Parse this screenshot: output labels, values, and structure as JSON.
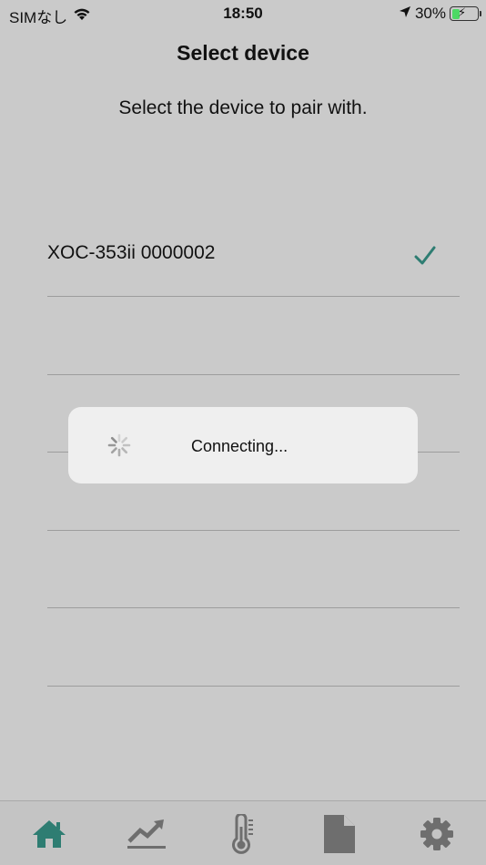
{
  "status_bar": {
    "carrier": "SIMなし",
    "time": "18:50",
    "battery": "30%",
    "battery_level": 0.3
  },
  "header": {
    "title": "Select device",
    "subtitle": "Select the device to pair with."
  },
  "devices": [
    {
      "name": "XOC-353ii 0000002",
      "selected": true
    },
    {
      "name": ""
    },
    {
      "name": ""
    },
    {
      "name": ""
    },
    {
      "name": ""
    },
    {
      "name": ""
    }
  ],
  "dialog": {
    "message": "Connecting..."
  },
  "tabs": [
    {
      "icon": "home-icon",
      "active": true
    },
    {
      "icon": "trend-chart-icon",
      "active": false
    },
    {
      "icon": "thermometer-icon",
      "active": false
    },
    {
      "icon": "document-icon",
      "active": false
    },
    {
      "icon": "gear-icon",
      "active": false
    }
  ],
  "colors": {
    "accent": "#2e7d72",
    "inactive_icon": "#6e6e6e",
    "background": "#cacaca"
  }
}
